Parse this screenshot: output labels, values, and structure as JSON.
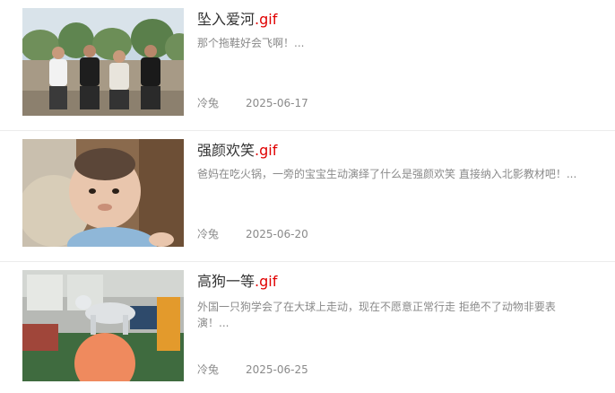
{
  "articles": [
    {
      "title": "坠入爱河",
      "title_ext": ".gif",
      "summary": "那个拖鞋好会飞啊！...",
      "author": "冷兔",
      "date": "2025-06-17",
      "thumbnail": "four-men-posing-photo"
    },
    {
      "title": "强颜欢笑",
      "title_ext": ".gif",
      "summary": "爸妈在吃火锅，一旁的宝宝生动演绎了什么是强颜欢笑 直接纳入北影教材吧！...",
      "author": "冷兔",
      "date": "2025-06-20",
      "thumbnail": "baby-face-photo"
    },
    {
      "title": "高狗一等",
      "title_ext": ".gif",
      "summary": "外国一只狗学会了在大球上走动，现在不愿意正常行走 拒绝不了动物非要表演！...",
      "author": "冷兔",
      "date": "2025-06-25",
      "thumbnail": "dog-on-ball-photo"
    }
  ],
  "colors": {
    "ext_accent": "#e00000",
    "title": "#333333",
    "muted": "#8a8a8a",
    "divider": "#ececec"
  }
}
